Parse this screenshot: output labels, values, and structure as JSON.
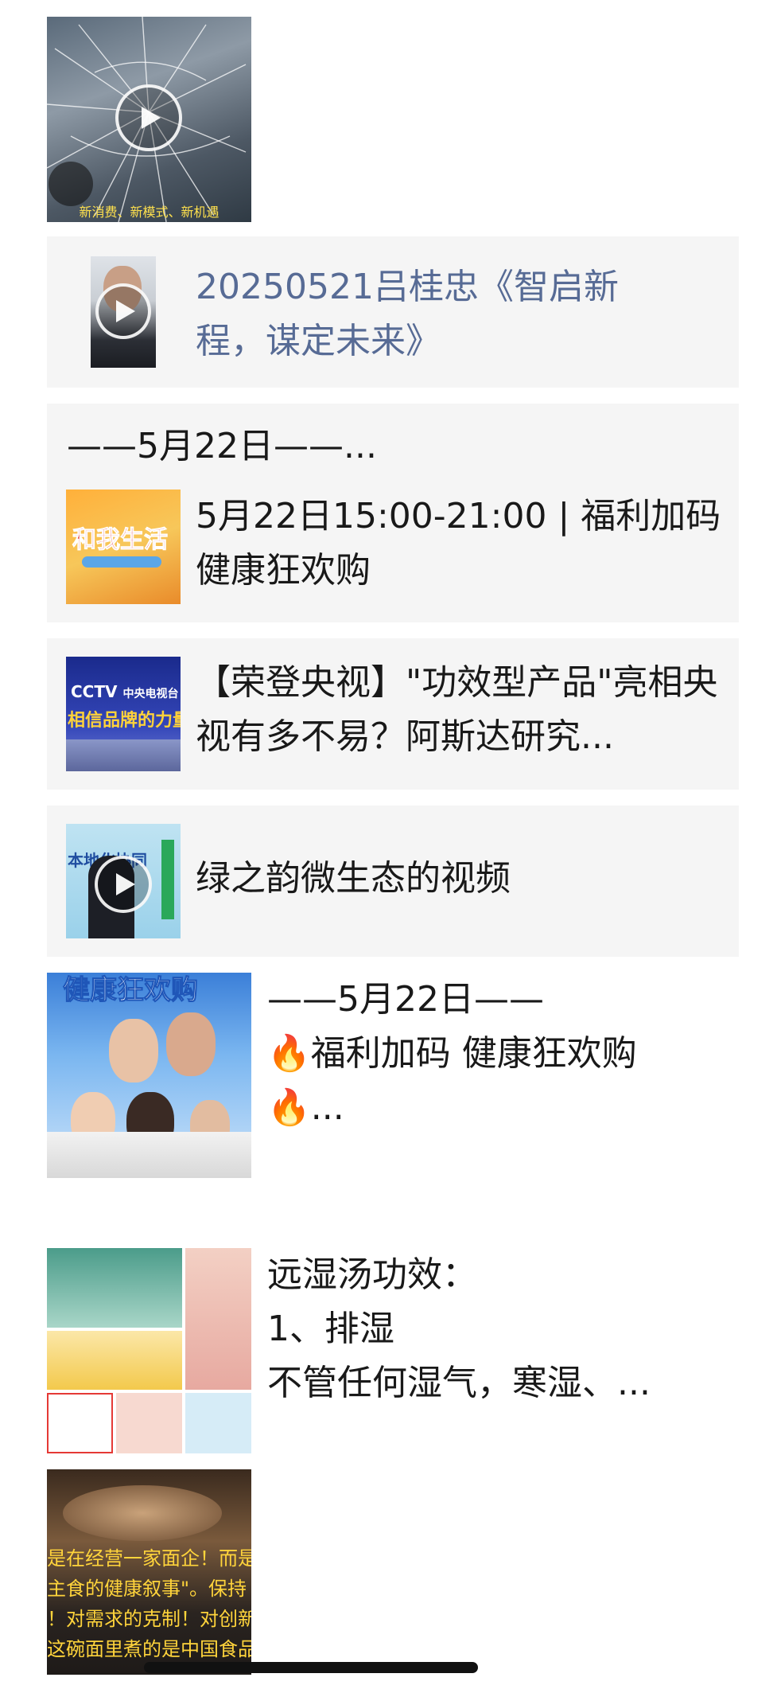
{
  "video1": {
    "caption": "新消费、新模式、新机遇"
  },
  "video2": {
    "title": "20250521吕桂忠《智启新程，谋定未来》"
  },
  "section1": {
    "header": "——5月22日——...",
    "article": {
      "title": "5月22日15:00-21:00 | 福利加码 健康狂欢购",
      "thumb_text": "和我生活"
    }
  },
  "article2": {
    "title": "【荣登央视】\"功效型产品\"亮相央视有多不易？阿斯达研究...",
    "thumb_logo": "CCTV",
    "thumb_channel": "中央电视台",
    "thumb_slogan": "相信品牌的力量"
  },
  "video3": {
    "title": "绿之韵微生态的视频",
    "thumb_text": "本地化协同"
  },
  "post1": {
    "line1": "——5月22日——",
    "line2": "福利加码 健康狂欢购",
    "line3": "...",
    "thumb_banner": "健康狂欢购",
    "fire_icon": "🔥"
  },
  "post2": {
    "line1": "远湿汤功效：",
    "line2": "1、排湿",
    "line3": "不管任何湿气，寒湿、..."
  },
  "post3": {
    "thumb_lines": [
      "是在经营一家面企！而是",
      "主食的健康叙事\"。保持",
      "！对需求的克制！对创新",
      "这碗面里煮的是中国食品"
    ]
  },
  "colors": {
    "link_blue": "#576b95",
    "card_bg": "#f5f5f5",
    "text": "#191919"
  }
}
